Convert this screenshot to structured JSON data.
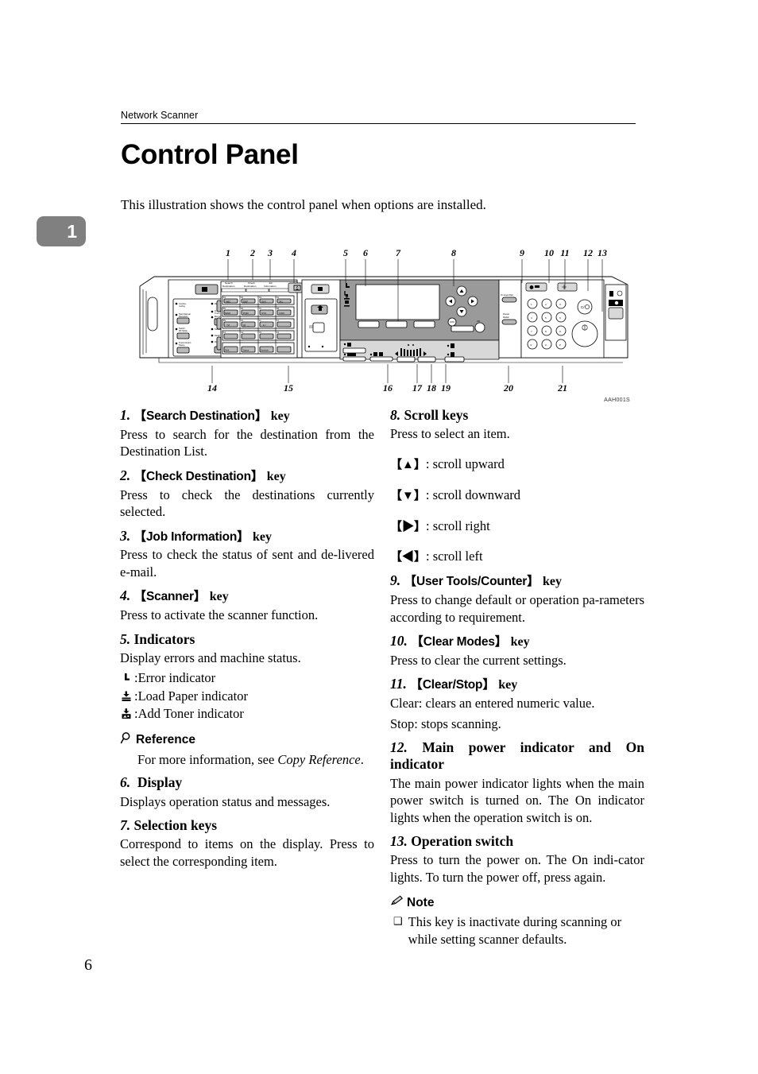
{
  "header": {
    "running_head": "Network Scanner"
  },
  "chapter_tab": {
    "number": "1"
  },
  "title": "Control Panel",
  "intro": "This illustration shows the control panel when options are installed.",
  "figure": {
    "code": "AAH001S",
    "top_callouts": [
      "1",
      "2",
      "3",
      "4",
      "5",
      "6",
      "7",
      "8",
      "9",
      "10",
      "11",
      "12",
      "13"
    ],
    "bottom_callouts": [
      "14",
      "15",
      "16",
      "17",
      "18",
      "19",
      "20",
      "21"
    ],
    "panel_labels": {
      "search_destination": "Search Destination",
      "check_destination": "Check Destination",
      "job_information": "Job Information",
      "on_hook_dial": "On Hook Dial",
      "pause_redial": "Pause/ Redial",
      "ok": "OK"
    },
    "quick_dial_labels": [
      "ABC",
      "DEF",
      "GHI",
      "JKL",
      "MNO",
      "PQR",
      "STU",
      "VWX",
      "YZ",
      "@ . _",
      "- & /",
      "Shift",
      "Space",
      "Symbols"
    ],
    "keypad_keys": [
      "1",
      "2",
      "3",
      "4",
      "5",
      "6",
      "7",
      "8",
      "9",
      "∗",
      "0",
      "#"
    ],
    "left_panel_labels": [
      "Continu- rouling",
      "Receive File",
      "Start Manual Reception",
      "Immediate Trans.",
      "Memory Trans.",
      "Switch RX Mode",
      "Standard",
      "Detail",
      "Fine",
      "Transmission Stamp"
    ]
  },
  "left_column": [
    {
      "num": "1.",
      "key": "Search Destination",
      "key_suffix": "key",
      "is_key": true,
      "body": "Press to search for the destination from the Destination List."
    },
    {
      "num": "2.",
      "key": "Check Destination",
      "key_suffix": "key",
      "is_key": true,
      "body": "Press to check the destinations currently selected."
    },
    {
      "num": "3.",
      "key": "Job Information",
      "key_suffix": "key",
      "is_key": true,
      "body": "Press to check the status of sent and de-livered e-mail."
    },
    {
      "num": "4.",
      "key": "Scanner",
      "key_suffix": "key",
      "is_key": true,
      "body": "Press to activate the scanner function."
    },
    {
      "num": "5.",
      "heading": "Indicators",
      "is_key": false,
      "body": "Display errors and machine status."
    },
    {
      "num": "6.",
      "heading": "Display",
      "is_key": false,
      "body": "Displays operation status and messages."
    },
    {
      "num": "7.",
      "heading": "Selection keys",
      "is_key": false,
      "body": "Correspond to items on the display. Press to select the corresponding item."
    }
  ],
  "indicators": [
    {
      "icon": "error-indicator-icon",
      "label": ":Error indicator"
    },
    {
      "icon": "load-paper-indicator-icon",
      "label": ":Load Paper indicator"
    },
    {
      "icon": "add-toner-indicator-icon",
      "label": ":Add Toner indicator"
    }
  ],
  "reference": {
    "icon": "magnifier-icon",
    "heading": "Reference",
    "text_before": "For more information, see ",
    "text_italic": "Copy Reference",
    "text_after": "."
  },
  "right_column": [
    {
      "num": "8.",
      "heading": "Scroll keys",
      "is_key": false,
      "body": "Press to select an item."
    },
    {
      "num": "9.",
      "key": "User Tools/Counter",
      "key_suffix": "key",
      "is_key": true,
      "body": "Press to change default or operation pa-rameters according to requirement."
    },
    {
      "num": "10.",
      "key": "Clear Modes",
      "key_suffix": "key",
      "is_key": true,
      "body": "Press to clear the current settings."
    },
    {
      "num": "11.",
      "key": "Clear/Stop",
      "key_suffix": "key",
      "is_key": true,
      "body_1": "Clear: clears an entered numeric value.",
      "body_2": "Stop: stops scanning."
    },
    {
      "num": "12.",
      "heading": "Main power indicator and On indicator",
      "is_key": false,
      "body": "The main power indicator lights when the main power switch is turned on. The On indicator lights when the operation switch is on."
    },
    {
      "num": "13.",
      "heading": "Operation switch",
      "is_key": false,
      "body": "Press to turn the power on. The On indi-cator lights. To turn the power off, press again."
    }
  ],
  "scroll_keys": [
    {
      "glyph": "▲",
      "label": ": scroll upward"
    },
    {
      "glyph": "▼",
      "label": ": scroll downward"
    },
    {
      "glyph": "▶",
      "label": ": scroll right"
    },
    {
      "glyph": "◀",
      "label": ": scroll left"
    }
  ],
  "note": {
    "icon": "pencil-icon",
    "heading": "Note",
    "bullet": "❑",
    "text": "This key is inactivate during scanning or while setting scanner defaults."
  },
  "page_number": "6",
  "brackets": {
    "open": "【",
    "close": "】"
  }
}
